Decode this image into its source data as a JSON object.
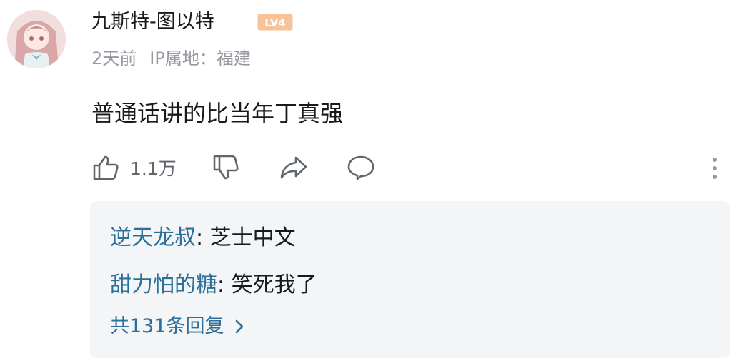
{
  "comment": {
    "username": "九斯特-图以特",
    "level": "LV4",
    "time": "2天前",
    "ip_location": "IP属地：福建",
    "content": "普通话讲的比当年丁真强",
    "like_count": "1.1万"
  },
  "replies": {
    "items": [
      {
        "user": "逆天龙叔",
        "separator": ": ",
        "text": "芝士中文"
      },
      {
        "user": "甜力怕的糖",
        "separator": ": ",
        "text": "笑死我了"
      }
    ],
    "total_label": "共131条回复"
  },
  "colors": {
    "username_link": "#2b6f9a",
    "meta_gray": "#9499a0",
    "level_badge": "#f3b07a",
    "reply_bg": "#f4f5f7"
  },
  "icons": [
    "thumbs-up-icon",
    "thumbs-down-icon",
    "share-icon",
    "comment-icon",
    "more-vertical-icon",
    "chevron-right-icon"
  ]
}
